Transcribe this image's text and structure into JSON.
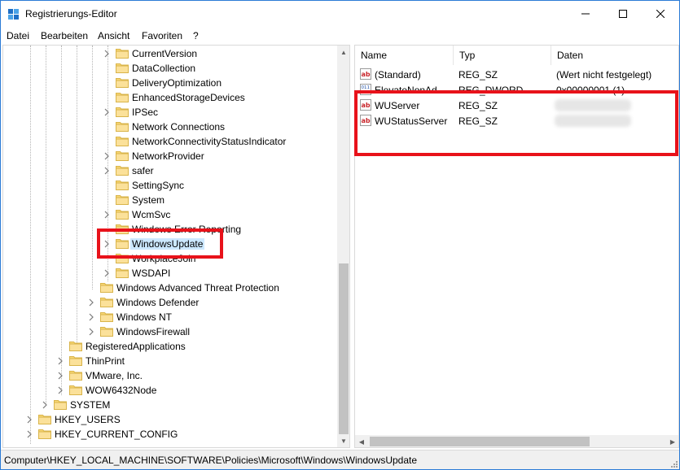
{
  "window": {
    "title": "Registrierungs-Editor"
  },
  "menu": [
    "Datei",
    "Bearbeiten",
    "Ansicht",
    "Favoriten",
    "?"
  ],
  "tree": [
    {
      "label": "CurrentVersion",
      "level": 5,
      "expandable": true
    },
    {
      "label": "DataCollection",
      "level": 5,
      "expandable": false
    },
    {
      "label": "DeliveryOptimization",
      "level": 5,
      "expandable": false
    },
    {
      "label": "EnhancedStorageDevices",
      "level": 5,
      "expandable": false
    },
    {
      "label": "IPSec",
      "level": 5,
      "expandable": true
    },
    {
      "label": "Network Connections",
      "level": 5,
      "expandable": false
    },
    {
      "label": "NetworkConnectivityStatusIndicator",
      "level": 5,
      "expandable": false
    },
    {
      "label": "NetworkProvider",
      "level": 5,
      "expandable": true
    },
    {
      "label": "safer",
      "level": 5,
      "expandable": true
    },
    {
      "label": "SettingSync",
      "level": 5,
      "expandable": false
    },
    {
      "label": "System",
      "level": 5,
      "expandable": false
    },
    {
      "label": "WcmSvc",
      "level": 5,
      "expandable": true
    },
    {
      "label": "Windows Error Reporting",
      "level": 5,
      "expandable": false
    },
    {
      "label": "WindowsUpdate",
      "level": 5,
      "expandable": true,
      "selected": true
    },
    {
      "label": "WorkplaceJoin",
      "level": 5,
      "expandable": false
    },
    {
      "label": "WSDAPI",
      "level": 5,
      "expandable": true
    },
    {
      "label": "Windows Advanced Threat Protection",
      "level": 4,
      "expandable": false
    },
    {
      "label": "Windows Defender",
      "level": 4,
      "expandable": true
    },
    {
      "label": "Windows NT",
      "level": 4,
      "expandable": true
    },
    {
      "label": "WindowsFirewall",
      "level": 4,
      "expandable": true
    },
    {
      "label": "RegisteredApplications",
      "level": 2,
      "expandable": false
    },
    {
      "label": "ThinPrint",
      "level": 2,
      "expandable": true
    },
    {
      "label": "VMware, Inc.",
      "level": 2,
      "expandable": true
    },
    {
      "label": "WOW6432Node",
      "level": 2,
      "expandable": true
    },
    {
      "label": "SYSTEM",
      "level": 1,
      "expandable": true
    },
    {
      "label": "HKEY_USERS",
      "level": 0,
      "expandable": true
    },
    {
      "label": "HKEY_CURRENT_CONFIG",
      "level": 0,
      "expandable": true
    }
  ],
  "list": {
    "columns": [
      "Name",
      "Typ",
      "Daten"
    ],
    "rows": [
      {
        "name": "(Standard)",
        "type": "REG_SZ",
        "data": "(Wert nicht festgelegt)",
        "icon": "string-value-icon"
      },
      {
        "name": "ElevateNonAd...",
        "type": "REG_DWORD",
        "data": "0x00000001 (1)",
        "icon": "dword-value-icon"
      },
      {
        "name": "WUServer",
        "type": "REG_SZ",
        "data": "",
        "icon": "string-value-icon",
        "redacted": true
      },
      {
        "name": "WUStatusServer",
        "type": "REG_SZ",
        "data": "",
        "icon": "string-value-icon",
        "redacted": true
      }
    ]
  },
  "status": {
    "path": "Computer\\HKEY_LOCAL_MACHINE\\SOFTWARE\\Policies\\Microsoft\\Windows\\WindowsUpdate"
  },
  "colors": {
    "highlight": "#e8121a",
    "selection": "#cce8ff",
    "folder": "#f8d775",
    "border": "#2b7bd6"
  }
}
